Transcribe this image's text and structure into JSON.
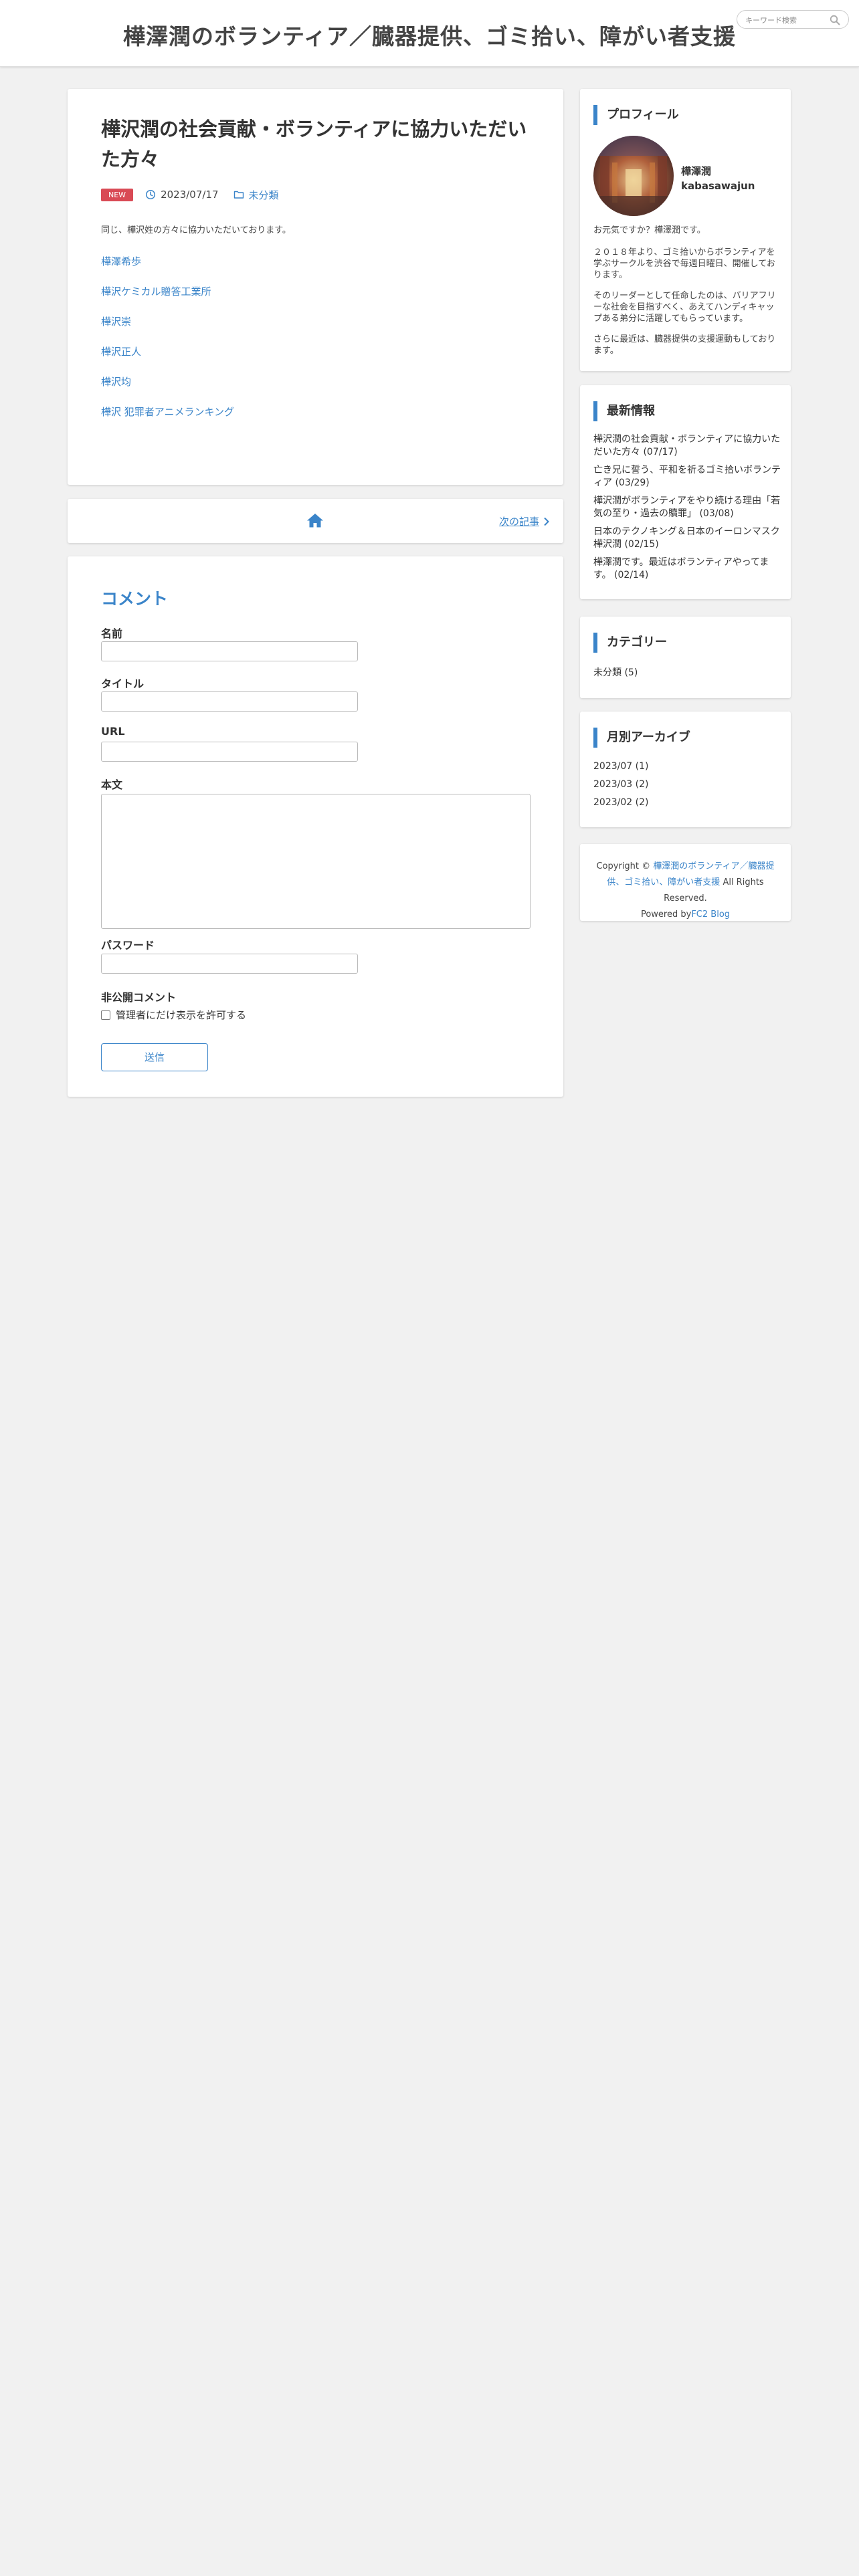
{
  "header": {
    "site_title": "樺澤潤のボランティア／臓器提供、ゴミ拾い、障がい者支援",
    "search_placeholder": "キーワード検索"
  },
  "article": {
    "title": "樺沢潤の社会貢献・ボランティアに協力いただいた方々",
    "badge": "NEW",
    "date": "2023/07/17",
    "category": "未分類",
    "body": "同じ、樺沢姓の方々に協力いただいております。",
    "links": [
      "樺澤希歩",
      "樺沢ケミカル贈答工業所",
      "樺沢崇",
      "樺沢正人",
      "樺沢均",
      "樺沢 犯罪者アニメランキング"
    ]
  },
  "post_nav": {
    "next_label": "次の記事"
  },
  "comments": {
    "heading": "コメント",
    "name_label": "名前",
    "title_label": "タイトル",
    "url_label": "URL",
    "body_label": "本文",
    "password_label": "パスワード",
    "private_label": "非公開コメント",
    "private_checkbox_label": "管理者にだけ表示を許可する",
    "submit_label": "送信"
  },
  "sidebar": {
    "profile": {
      "title": "プロフィール",
      "name_line1": "樺澤潤",
      "name_line2": "kabasawajun",
      "para1": "お元気ですか？樺澤潤です。",
      "para2": "２０１８年より、ゴミ拾いからボランティアを学ぶサークルを渋谷で毎週日曜日、開催しております。",
      "para3": "そのリーダーとして任命したのは、バリアフリーな社会を目指すべく、あえてハンディキャップある弟分に活躍してもらっています。",
      "para4": "さらに最近は、臓器提供の支援運動もしております。"
    },
    "recent": {
      "title": "最新情報",
      "items": [
        "樺沢潤の社会貢献・ボランティアに協力いただいた方々 (07/17)",
        "亡き兄に誓う、平和を祈るゴミ拾いボランティア (03/29)",
        "樺沢潤がボランティアをやり続ける理由「若気の至り・過去の贖罪」 (03/08)",
        "日本のテクノキング＆日本のイーロンマスク 樺沢潤 (02/15)",
        "樺澤潤です。最近はボランティアやってます。 (02/14)"
      ]
    },
    "categories": {
      "title": "カテゴリー",
      "items": [
        "未分類 (5)"
      ]
    },
    "archives": {
      "title": "月別アーカイブ",
      "items": [
        "2023/07 (1)",
        "2023/03 (2)",
        "2023/02 (2)"
      ]
    }
  },
  "footer": {
    "copyright_prefix": "Copyright ©",
    "site_link": "樺澤潤のボランティア／臓器提供、ゴミ拾い、障がい者支援",
    "rights": "All Rights Reserved.",
    "powered_prefix": "Powered by",
    "powered_link": "FC2 Blog"
  }
}
